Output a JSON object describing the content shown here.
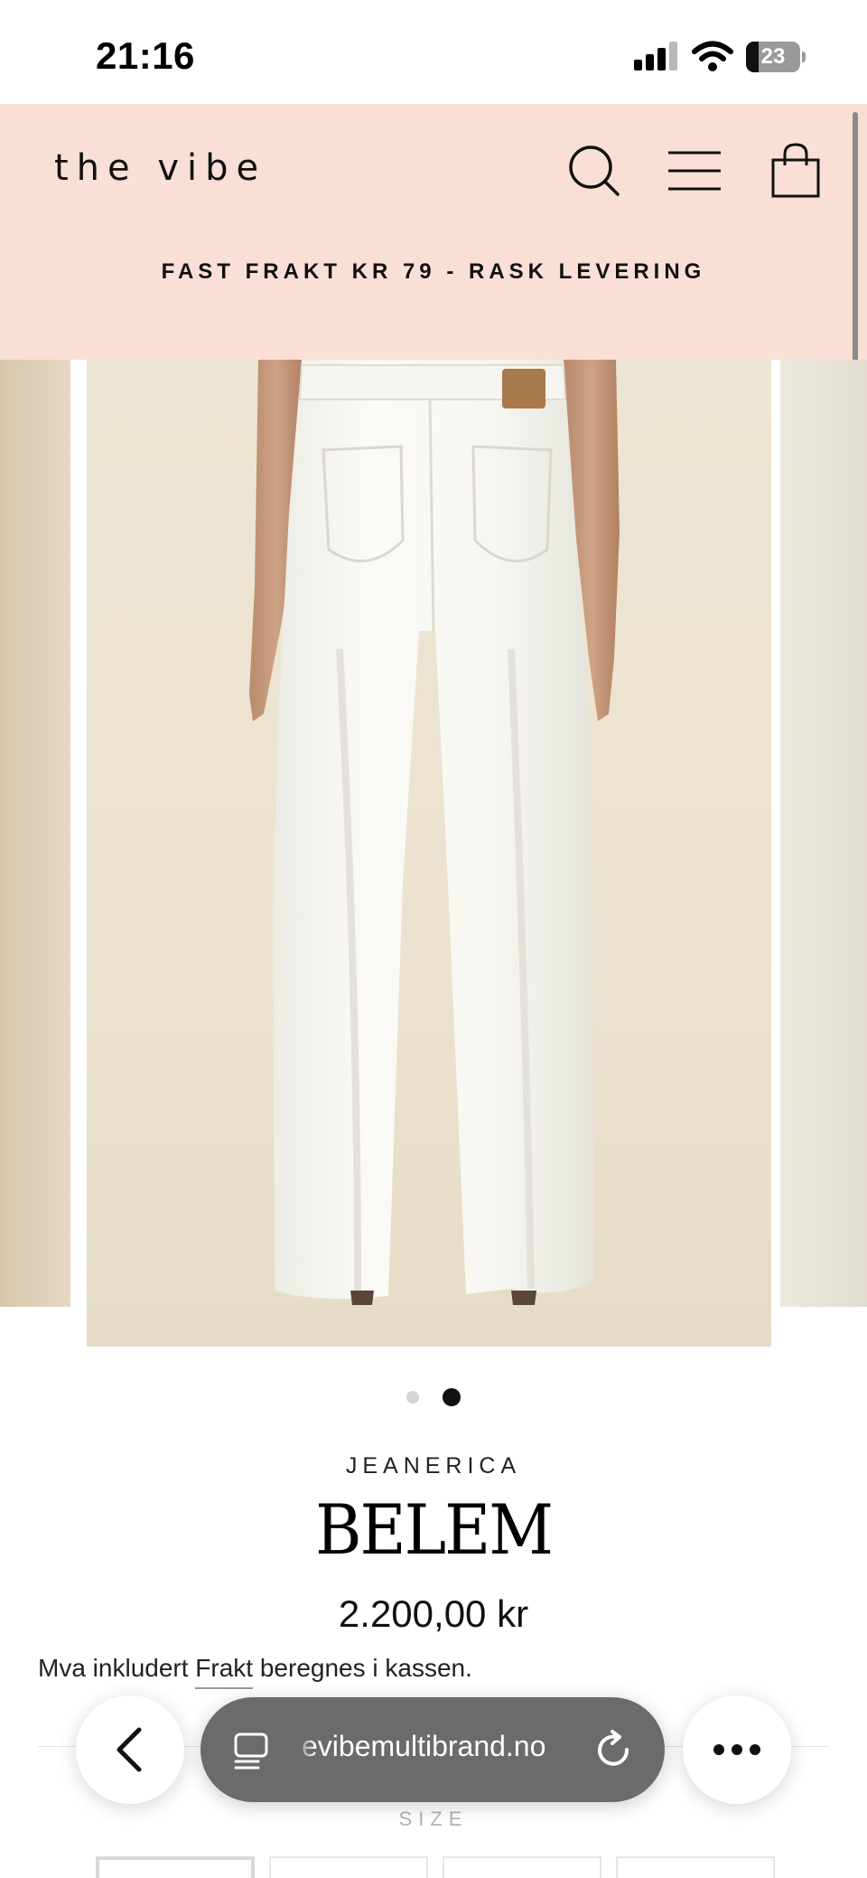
{
  "status_bar": {
    "time": "21:16",
    "battery_level": "23",
    "signal_icon": "cellular-signal-icon",
    "wifi_icon": "wifi-icon"
  },
  "header": {
    "logo": "the vibe",
    "icons": [
      "search-icon",
      "hamburger-menu-icon",
      "shopping-bag-icon"
    ],
    "background_color": "#f9dfd5"
  },
  "announcement": "FAST FRAKT KR 79 - RASK LEVERING",
  "gallery": {
    "image_subject": "white wide-leg jeans",
    "slide_count": 2,
    "active_slide": 2
  },
  "product": {
    "brand": "JEANERICA",
    "title": "BELEM",
    "price": "2.200,00 kr",
    "tax_text_before": "Mva inkludert ",
    "shipping_link": "Frakt",
    "tax_text_after": " beregnes i kassen.",
    "size_label": "SIZE"
  },
  "browser": {
    "url": "evibemultibrand.no",
    "icons": [
      "back-chevron-icon",
      "page-menu-icon",
      "reload-icon",
      "more-dots-icon"
    ]
  }
}
